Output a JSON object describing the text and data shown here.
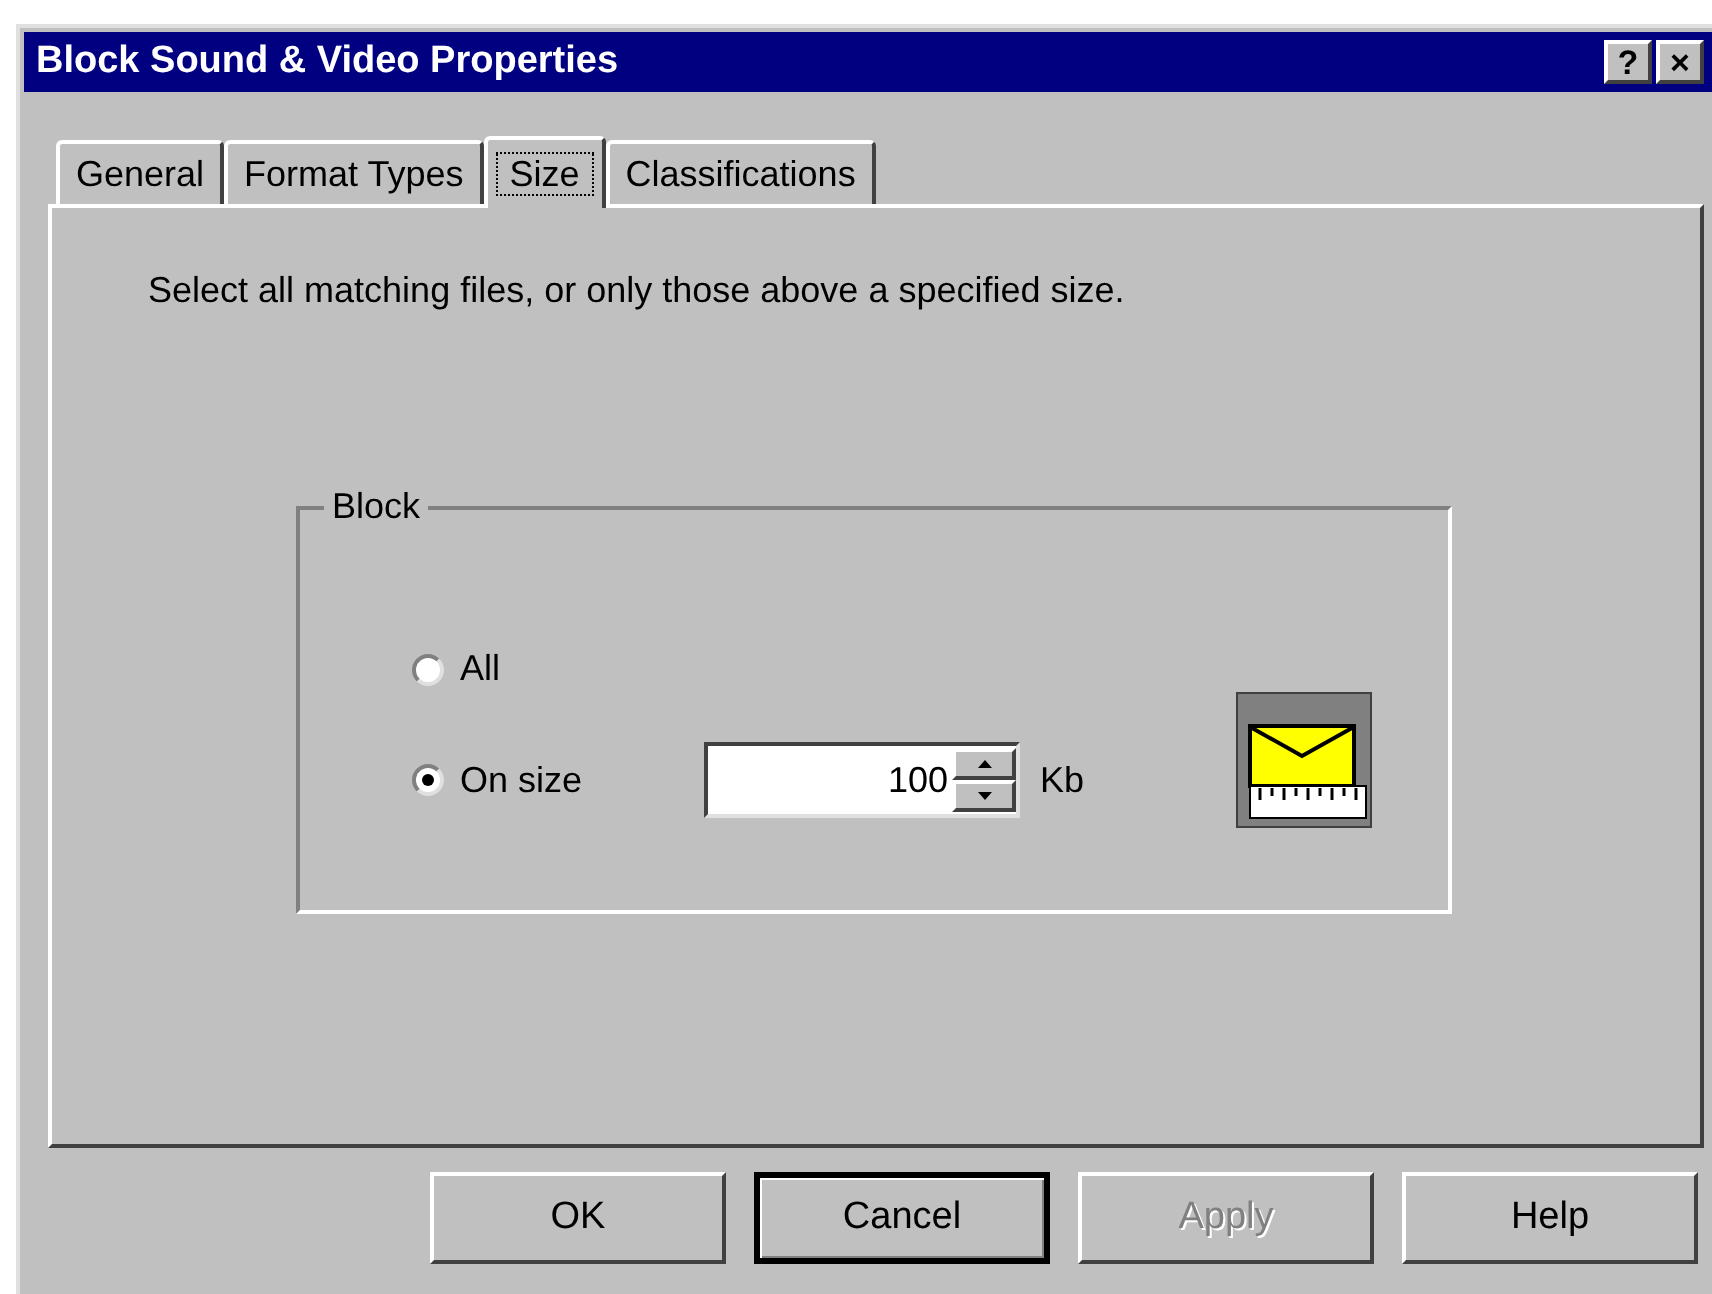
{
  "window": {
    "title": "Block Sound & Video Properties",
    "title_buttons": [
      "?",
      "×"
    ]
  },
  "tabs": [
    {
      "label": "General",
      "selected": false
    },
    {
      "label": "Format Types",
      "selected": false
    },
    {
      "label": "Size",
      "selected": true
    },
    {
      "label": "Classifications",
      "selected": false
    }
  ],
  "description": "Select all matching files, or only those above a specified size.",
  "group": {
    "title": "Block",
    "options": [
      {
        "label": "All",
        "selected": false
      },
      {
        "label": "On size",
        "selected": true
      }
    ],
    "size_value": "100",
    "unit": "Kb"
  },
  "buttons": [
    {
      "label": "OK",
      "default": false,
      "disabled": false
    },
    {
      "label": "Cancel",
      "default": true,
      "disabled": false
    },
    {
      "label": "Apply",
      "default": false,
      "disabled": true
    },
    {
      "label": "Help",
      "default": false,
      "disabled": false
    }
  ]
}
